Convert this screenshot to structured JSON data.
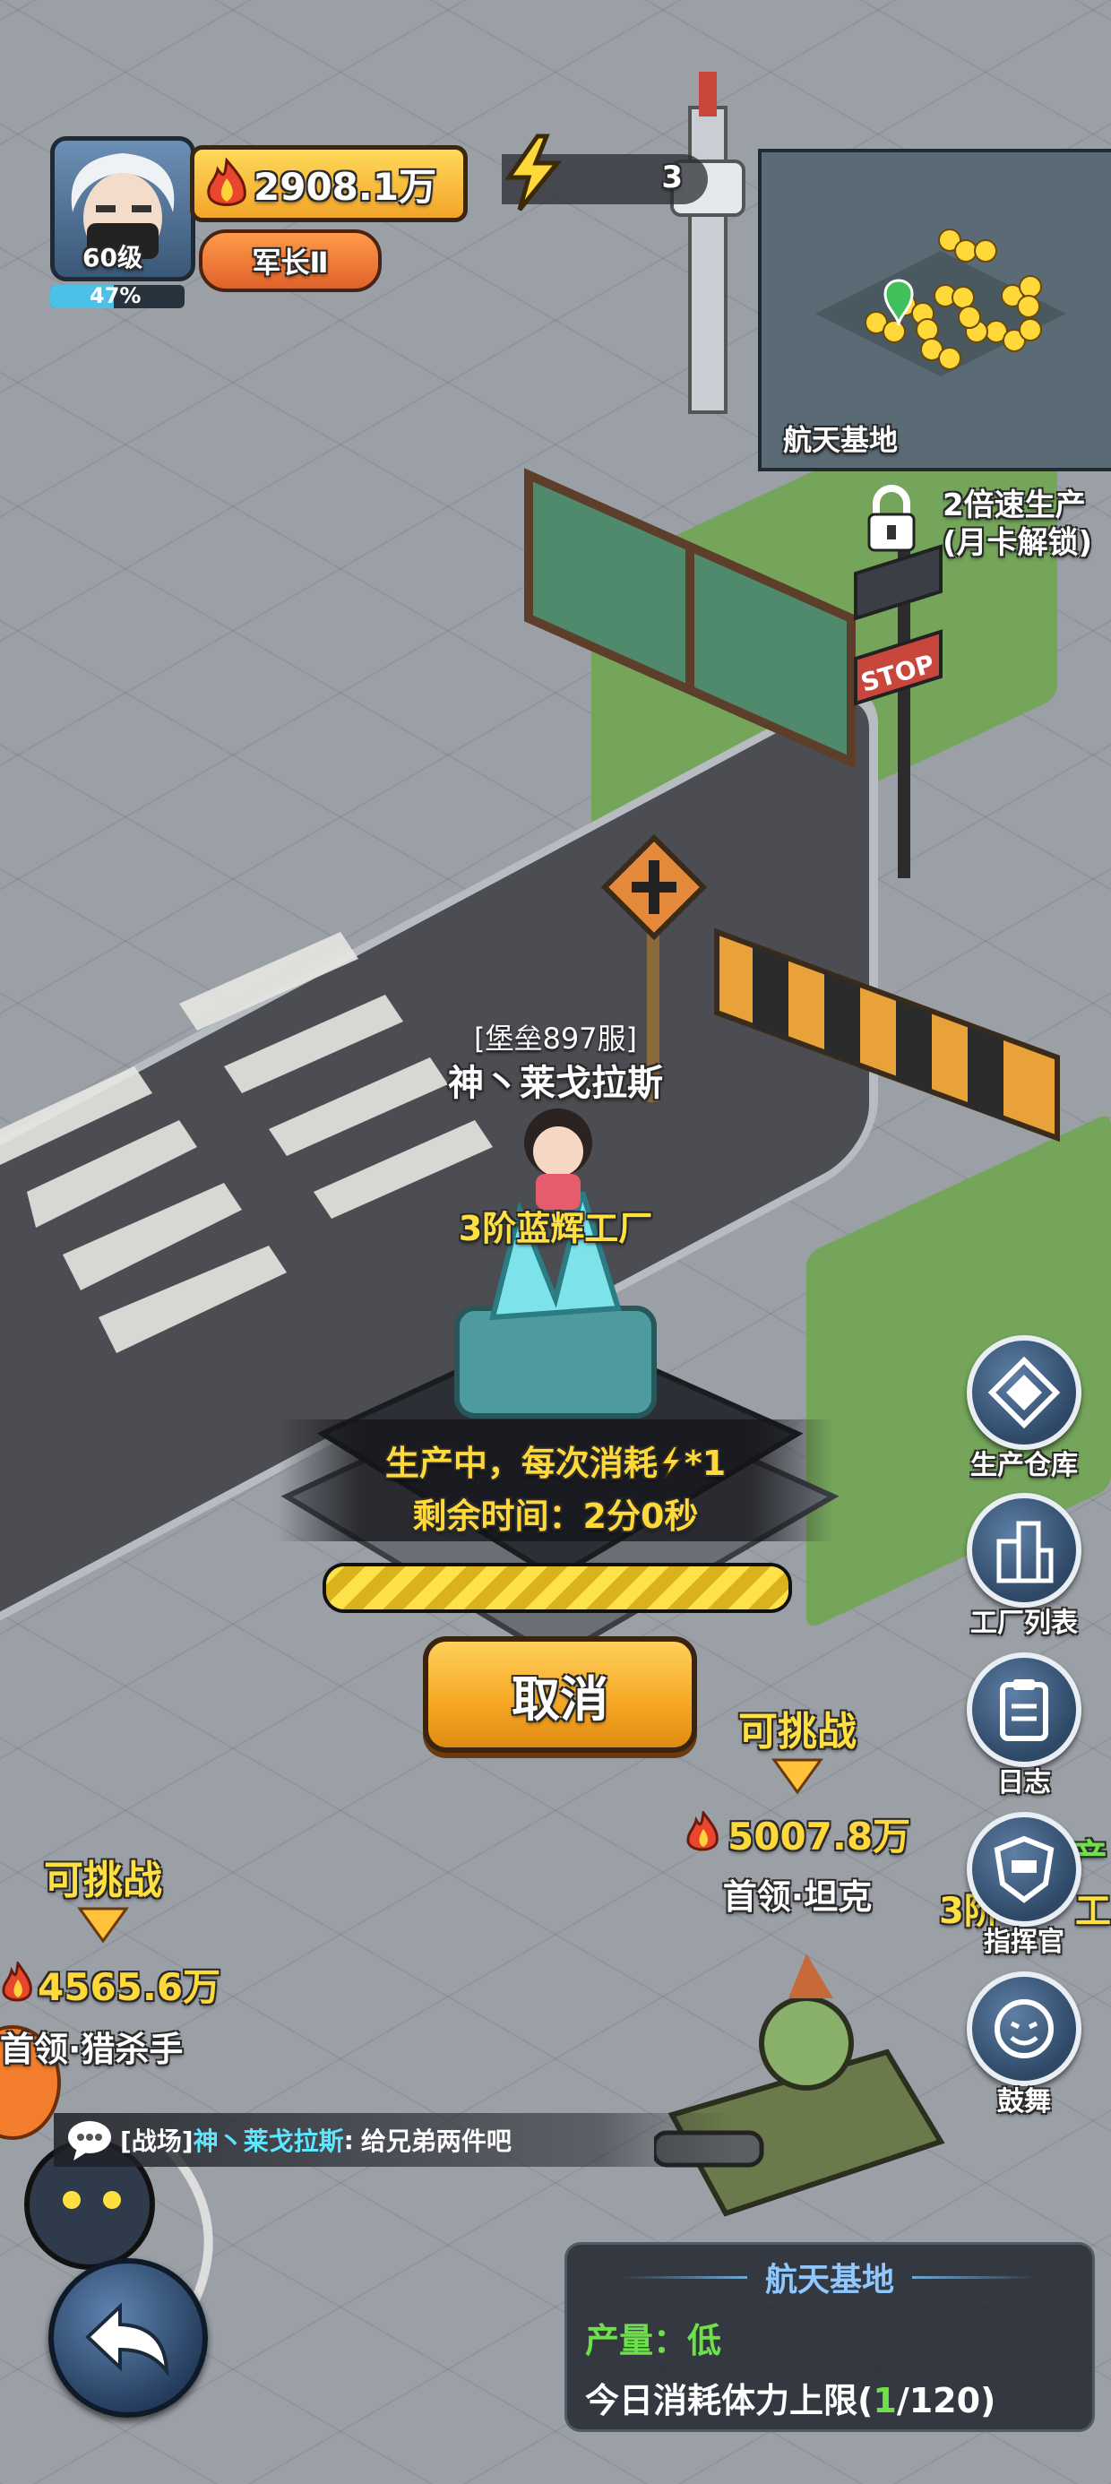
{
  "player": {
    "level": "60级",
    "power": "2908.1万",
    "rank": "军长Ⅱ",
    "exp_percent_text": "47%",
    "exp_fraction": 0.47
  },
  "energy": {
    "count": "3"
  },
  "minimap": {
    "label": "航天基地"
  },
  "speed_boost": {
    "line1": "2倍速生产",
    "line2": "(月卡解锁)"
  },
  "world": {
    "stop_sign": "STOP",
    "factory_player_server": "[堡垒897服]",
    "factory_player_name": "神丶莱戈拉斯",
    "factory_name": "3阶蓝辉工厂",
    "production_line1_prefix": "生产中，每次消耗",
    "production_line1_suffix": "*1",
    "production_line2": "剩余时间：2分0秒",
    "progress_fraction": 1.0,
    "cancel_label": "取消",
    "peek_text1": "产",
    "peek_text2": "3阶",
    "peek_text3": "工"
  },
  "enemies": [
    {
      "status": "可挑战",
      "power": "5007.8万",
      "name": "首领·坦克"
    },
    {
      "status": "可挑战",
      "power": "4565.6万",
      "name": "首领·猎杀手"
    }
  ],
  "side_menu": {
    "warehouse": "生产仓库",
    "factory_list": "工厂列表",
    "log": "日志",
    "commander": "指挥官",
    "encourage": "鼓舞"
  },
  "chat": {
    "channel": "[战场]",
    "sender": "神丶莱戈拉斯",
    "separator": ":",
    "message": "给兄弟两件吧"
  },
  "base_info": {
    "title": "航天基地",
    "output_label": "产量：",
    "output_value": "低",
    "stamina_prefix": "今日消耗体力上限(",
    "stamina_used": "1",
    "stamina_suffix": "/120)"
  },
  "colors": {
    "accent_yellow": "#ffd83a",
    "green_text": "#6ee04a",
    "cyan_text": "#5ee6ff",
    "button_orange": "#f5a623"
  }
}
